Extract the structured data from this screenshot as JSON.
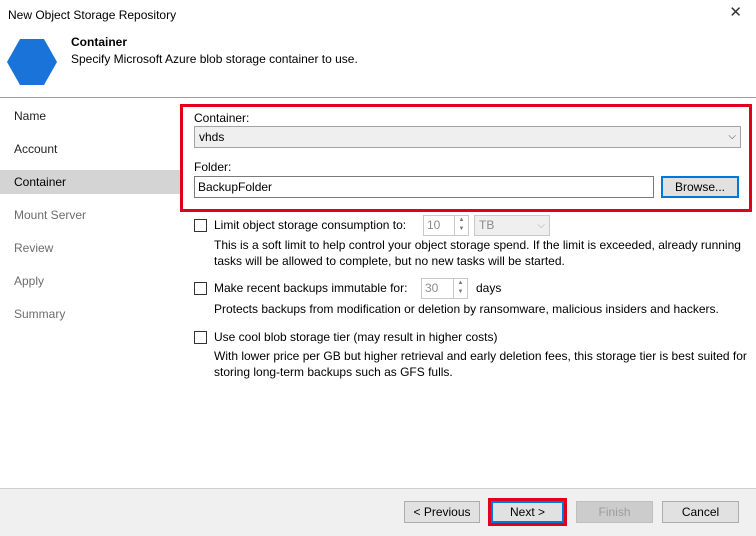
{
  "window": {
    "title": "New Object Storage Repository",
    "close_glyph": "✕"
  },
  "header": {
    "title": "Container",
    "subtitle": "Specify Microsoft Azure blob storage container to use.",
    "icon_color": "#1a73d8"
  },
  "nav": {
    "items": [
      {
        "label": "Name",
        "state": "normal"
      },
      {
        "label": "Account",
        "state": "normal"
      },
      {
        "label": "Container",
        "state": "selected"
      },
      {
        "label": "Mount Server",
        "state": "disabled"
      },
      {
        "label": "Review",
        "state": "disabled"
      },
      {
        "label": "Apply",
        "state": "disabled"
      },
      {
        "label": "Summary",
        "state": "disabled"
      }
    ]
  },
  "form": {
    "container_label": "Container:",
    "container_value": "vhds",
    "folder_label": "Folder:",
    "folder_value": "BackupFolder",
    "browse_label": "Browse..."
  },
  "options": {
    "limit": {
      "label": "Limit object storage consumption to:",
      "checked": false,
      "value": "10",
      "unit": "TB",
      "desc1": "This is a soft limit to help control your object storage spend. If the limit is exceeded, already running",
      "desc2": "tasks will be allowed to complete, but no new tasks will be started."
    },
    "immutable": {
      "label": "Make recent backups immutable for:",
      "checked": false,
      "value": "30",
      "unit": "days",
      "desc": "Protects backups from modification or deletion by ransomware, malicious insiders and hackers."
    },
    "cool_tier": {
      "label": "Use cool blob storage tier (may result in higher costs)",
      "checked": false,
      "desc1": "With lower price per GB but higher retrieval and early deletion fees, this storage tier is best suited for",
      "desc2": "storing long-term backups such as GFS fulls."
    }
  },
  "footer": {
    "previous_label": "< Previous",
    "next_label": "Next >",
    "finish_label": "Finish",
    "cancel_label": "Cancel"
  },
  "colors": {
    "highlight": "#e0001b",
    "selected_nav": "#d4d4d4"
  }
}
